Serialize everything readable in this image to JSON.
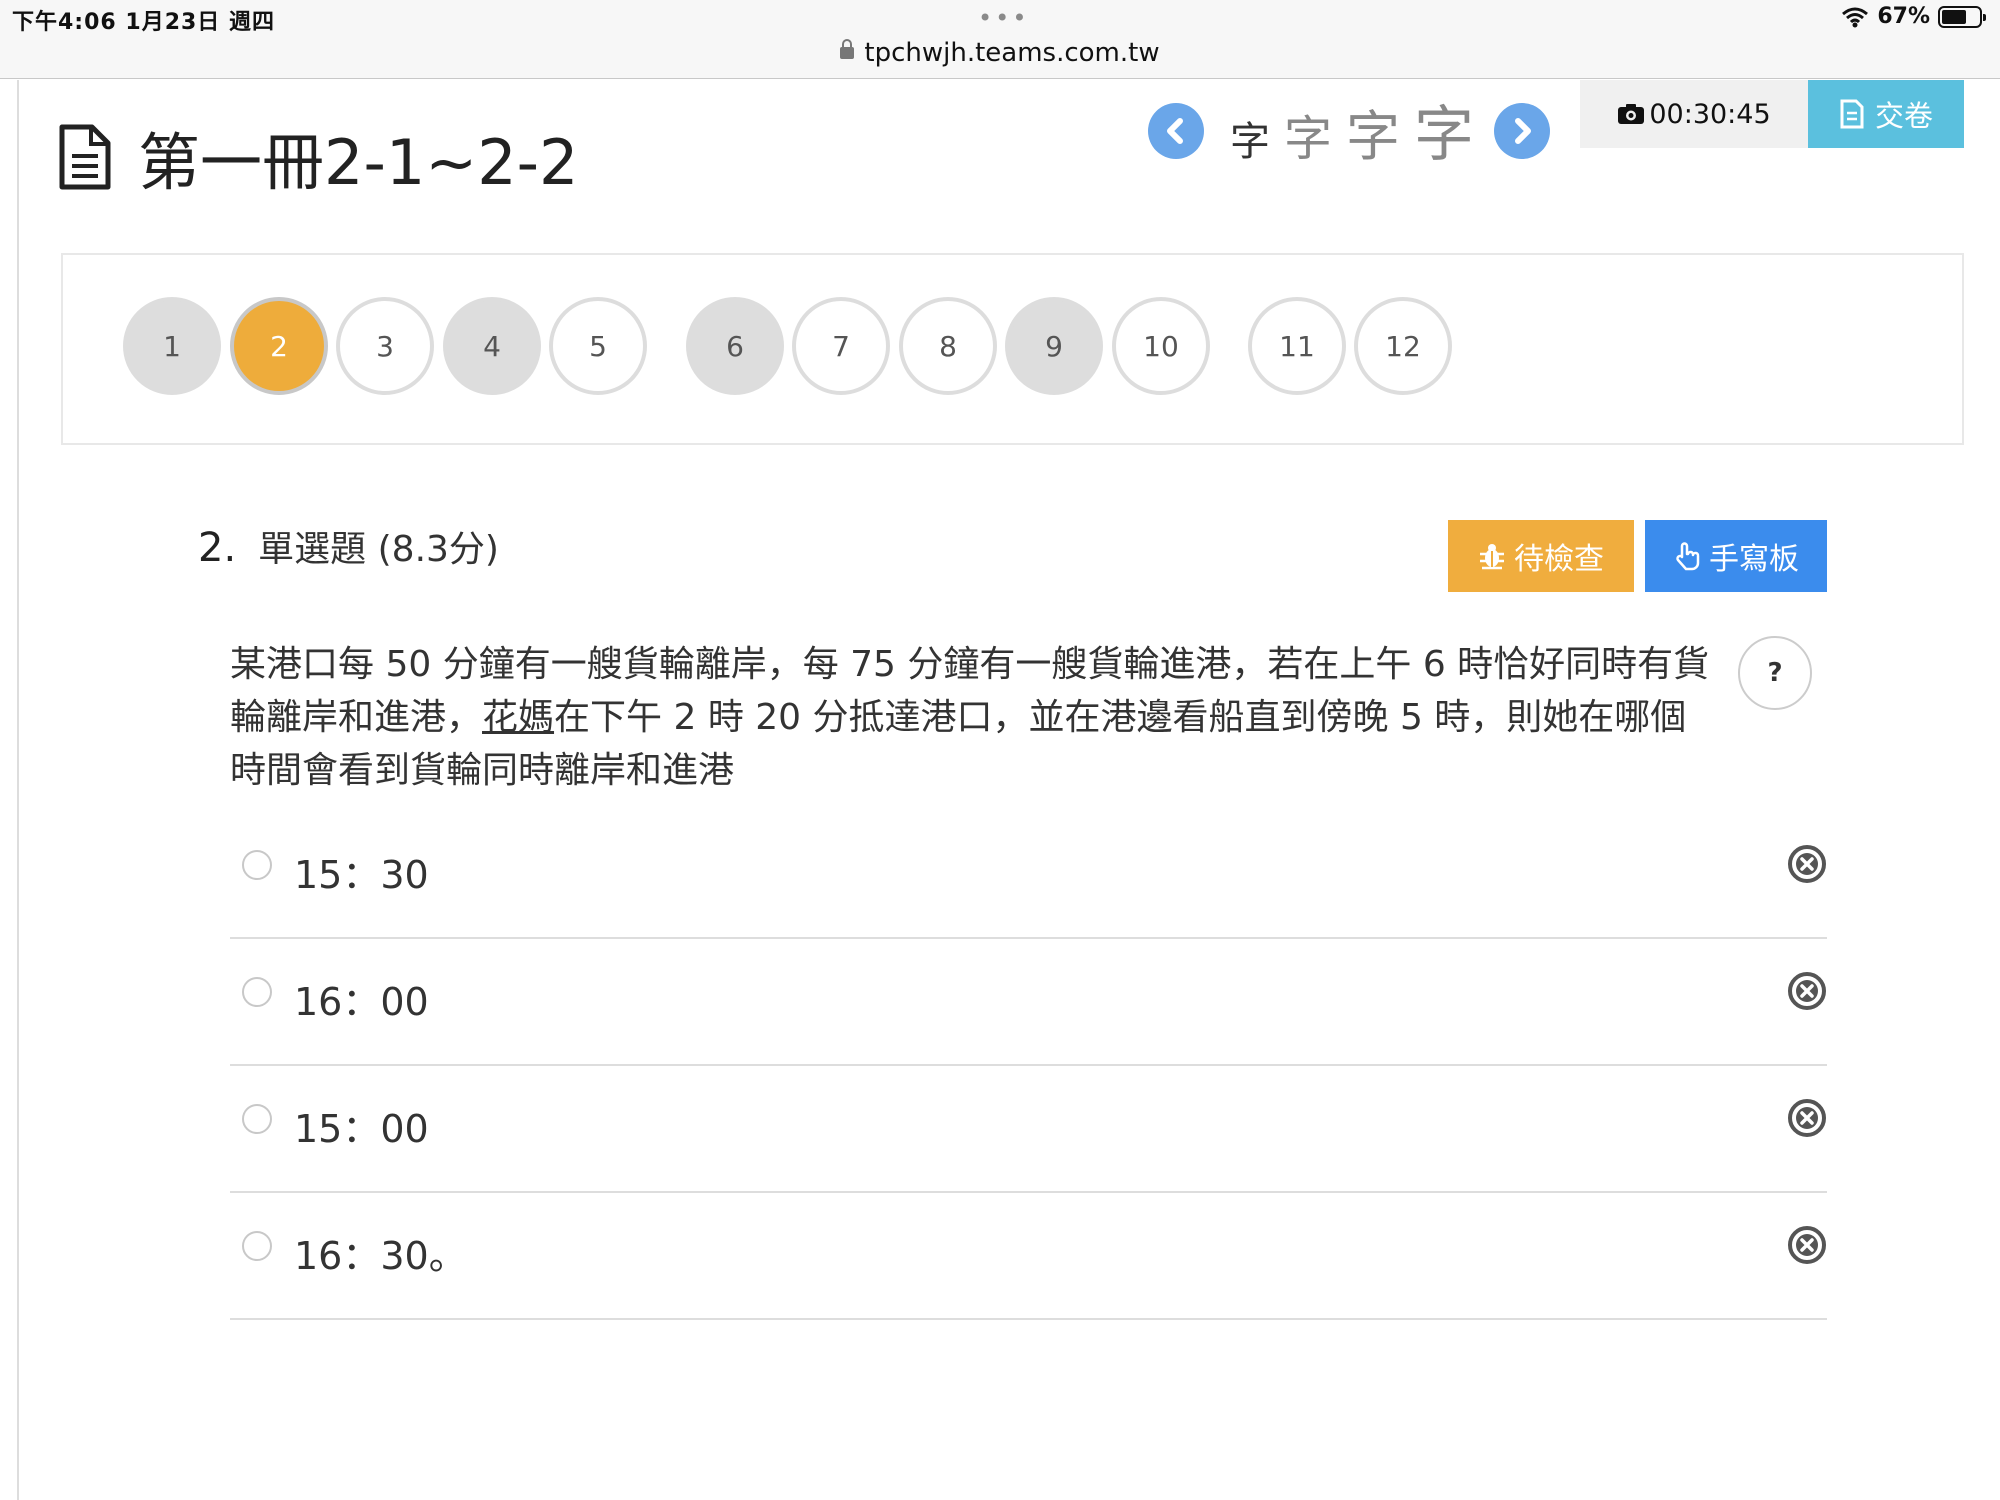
{
  "status_bar": {
    "time": "下午4:06   1月23日 週四",
    "dots": "•••",
    "url": "tpchwjh.teams.com.tw",
    "battery": "67%",
    "battery_level": 0.67
  },
  "header": {
    "title": "第一冊2-1~2-2",
    "font_size_options": [
      "字",
      "字",
      "字",
      "字"
    ],
    "timer": "00:30:45",
    "submit_label": "交卷"
  },
  "question_nav": {
    "items": [
      {
        "label": "1",
        "state": "answered"
      },
      {
        "label": "2",
        "state": "current"
      },
      {
        "label": "3",
        "state": "unanswered"
      },
      {
        "label": "4",
        "state": "answered"
      },
      {
        "label": "5",
        "state": "unanswered"
      },
      {
        "label": "6",
        "state": "answered"
      },
      {
        "label": "7",
        "state": "unanswered"
      },
      {
        "label": "8",
        "state": "unanswered"
      },
      {
        "label": "9",
        "state": "answered"
      },
      {
        "label": "10",
        "state": "unanswered"
      },
      {
        "label": "11",
        "state": "unanswered"
      },
      {
        "label": "12",
        "state": "unanswered"
      }
    ]
  },
  "question": {
    "number": "2.",
    "type": "單選題 (8.3分)",
    "pending_label": "待檢查",
    "handwrite_label": "手寫板",
    "stem_part1": "某港口每 50 分鐘有一艘貨輪離岸，每 75 分鐘有一艘貨輪進港，若在上午 6 時恰好同時有貨輪離岸和進港，",
    "stem_name": "花媽",
    "stem_part2": "在下午 2 時 20 分抵達港口，並在港邊看船直到傍晚 5 時，則她在哪個時間會看到貨輪同時離岸和進港",
    "help_label": "?",
    "options": [
      "15：30",
      "16：00",
      "15：00",
      "16：30。"
    ]
  },
  "colors": {
    "current_question": "#eeac3b",
    "answered_question": "#dddddd",
    "submit": "#5bc0de",
    "pending": "#f0ad3e",
    "handwrite": "#3b8ced",
    "nav_arrow": "#6aa6e9"
  }
}
